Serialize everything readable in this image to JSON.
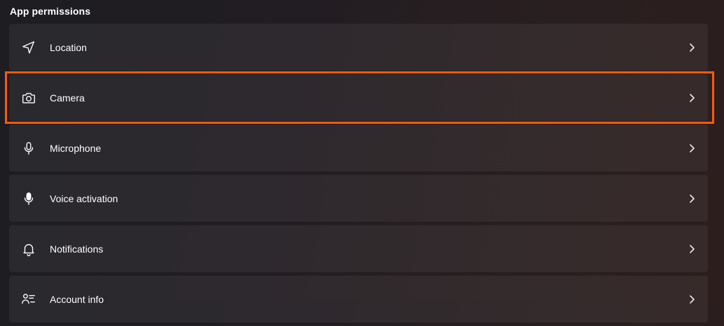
{
  "section": {
    "title": "App permissions"
  },
  "permissions": [
    {
      "label": "Location",
      "icon": "location-arrow-icon"
    },
    {
      "label": "Camera",
      "icon": "camera-icon"
    },
    {
      "label": "Microphone",
      "icon": "microphone-icon"
    },
    {
      "label": "Voice activation",
      "icon": "voice-activation-icon"
    },
    {
      "label": "Notifications",
      "icon": "bell-icon"
    },
    {
      "label": "Account info",
      "icon": "account-info-icon"
    }
  ],
  "highlight": {
    "target": "Camera",
    "color": "#ff5a0a"
  }
}
